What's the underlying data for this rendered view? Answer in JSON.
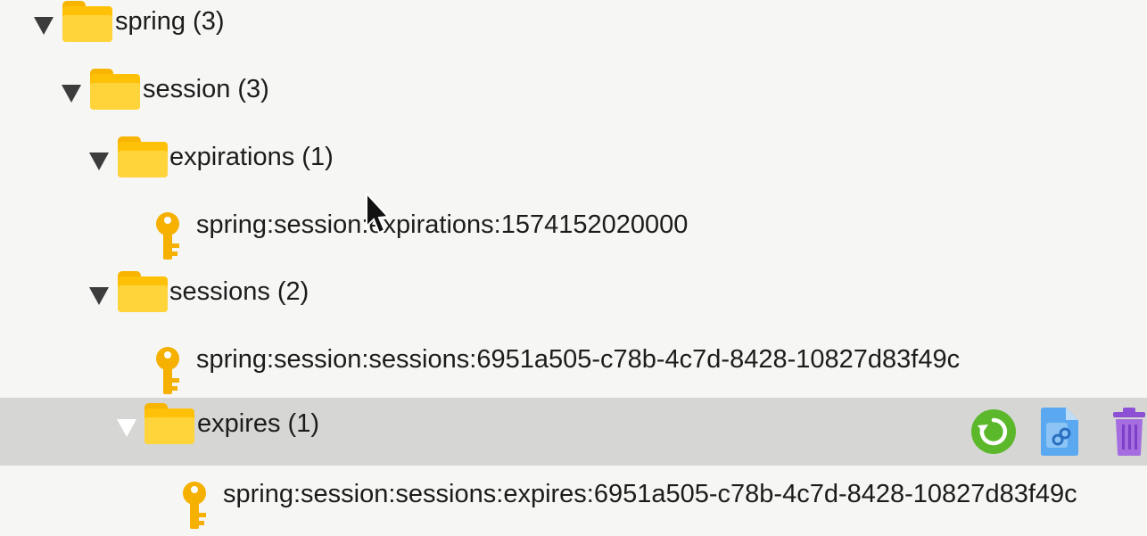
{
  "tree": {
    "spring": {
      "label": "spring (3)"
    },
    "session": {
      "label": "session (3)"
    },
    "expirations": {
      "label": "expirations (1)"
    },
    "expirations_key": {
      "label": "spring:session:expirations:1574152020000"
    },
    "sessions": {
      "label": "sessions (2)"
    },
    "sessions_key": {
      "label": "spring:session:sessions:6951a505-c78b-4c7d-8428-10827d83f49c"
    },
    "expires": {
      "label": "expires (1)"
    },
    "expires_key": {
      "label": "spring:session:sessions:expires:6951a505-c78b-4c7d-8428-10827d83f49c"
    }
  },
  "row_actions": {
    "icons": [
      "reload-icon",
      "copy-link-icon",
      "delete-icon"
    ]
  },
  "colors": {
    "folder": "#ffc107",
    "key": "#f5b000",
    "selected_row": "#d6d6d4",
    "reload": "#5cb82b",
    "copy": "#5aa8f0",
    "delete": "#a56de0"
  }
}
